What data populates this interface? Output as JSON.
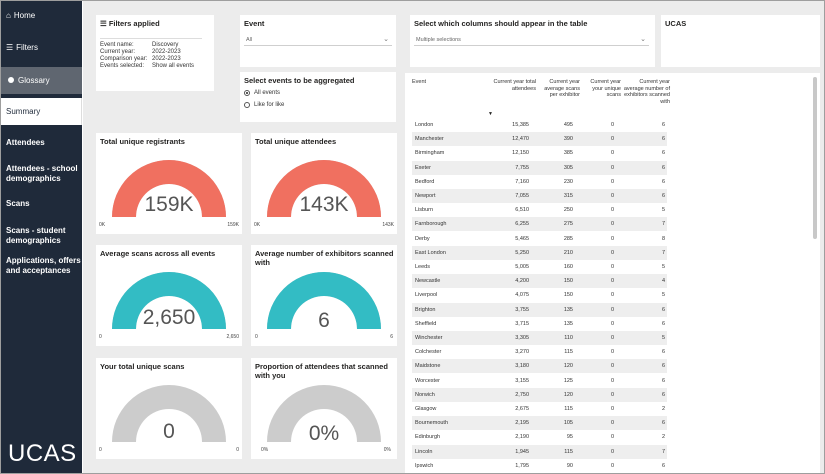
{
  "sidebar": {
    "home": "Home",
    "filters": "Filters",
    "glossary": "Glossary",
    "items": [
      {
        "label": "Summary"
      },
      {
        "label": "Attendees"
      },
      {
        "label": "Attendees - school demographics"
      },
      {
        "label": "Scans"
      },
      {
        "label": "Scans - student demographics"
      },
      {
        "label": "Applications, offers and acceptances"
      }
    ],
    "logo": "UCAS"
  },
  "filters_card": {
    "title": "Filters applied",
    "rows": [
      {
        "k": "Event name:",
        "v": "Discovery"
      },
      {
        "k": "Current year:",
        "v": "2022-2023"
      },
      {
        "k": "Comparison year:",
        "v": "2022-2023"
      },
      {
        "k": "Events selected:",
        "v": "Show all events"
      }
    ]
  },
  "event_filter": {
    "title": "Event",
    "value": "All"
  },
  "aggregate": {
    "title": "Select events to be aggregated",
    "options": [
      {
        "label": "All events",
        "selected": true
      },
      {
        "label": "Like for like",
        "selected": false
      }
    ]
  },
  "columns_filter": {
    "title": "Select which columns should appear in the table",
    "value": "Multiple selections"
  },
  "ucas_card": {
    "title": "UCAS"
  },
  "gauges": [
    {
      "title": "Total unique registrants",
      "value": "159K",
      "min": "0K",
      "max": "159K",
      "fraction": 1.0,
      "color": "#f07060"
    },
    {
      "title": "Total unique attendees",
      "value": "143K",
      "min": "0K",
      "max": "143K",
      "fraction": 1.0,
      "color": "#f07060"
    },
    {
      "title": "Average scans across all events",
      "value": "2,650",
      "min": "0",
      "max": "2,650",
      "fraction": 1.0,
      "color": "#33bcc4"
    },
    {
      "title": "Average number of exhibitors scanned with",
      "value": "6",
      "min": "0",
      "max": "6",
      "fraction": 1.0,
      "color": "#33bcc4"
    },
    {
      "title": "Your total unique scans",
      "value": "0",
      "min": "0",
      "max": "0",
      "fraction": 0.0,
      "color": "#cccccc"
    },
    {
      "title": "Proportion of attendees that scanned with you",
      "value": "0%",
      "min": "0%",
      "max": "0%",
      "fraction": 0.0,
      "color": "#cccccc"
    }
  ],
  "table": {
    "headers": [
      "Event",
      "Current year total attendees",
      "Current year average scans per exhibitor",
      "Current year your unique scans",
      "Current year average number of exhibitors scanned with"
    ],
    "rows": [
      [
        "London",
        "15,385",
        "495",
        "0",
        "6"
      ],
      [
        "Manchester",
        "12,470",
        "390",
        "0",
        "6"
      ],
      [
        "Birmingham",
        "12,150",
        "385",
        "0",
        "6"
      ],
      [
        "Exeter",
        "7,755",
        "305",
        "0",
        "6"
      ],
      [
        "Bedford",
        "7,160",
        "230",
        "0",
        "6"
      ],
      [
        "Newport",
        "7,055",
        "315",
        "0",
        "6"
      ],
      [
        "Lisburn",
        "6,510",
        "250",
        "0",
        "5"
      ],
      [
        "Farnborough",
        "6,255",
        "275",
        "0",
        "7"
      ],
      [
        "Derby",
        "5,465",
        "285",
        "0",
        "8"
      ],
      [
        "East London",
        "5,250",
        "210",
        "0",
        "7"
      ],
      [
        "Leeds",
        "5,005",
        "160",
        "0",
        "5"
      ],
      [
        "Newcastle",
        "4,200",
        "150",
        "0",
        "4"
      ],
      [
        "Liverpool",
        "4,075",
        "150",
        "0",
        "5"
      ],
      [
        "Brighton",
        "3,755",
        "135",
        "0",
        "6"
      ],
      [
        "Sheffield",
        "3,715",
        "135",
        "0",
        "6"
      ],
      [
        "Winchester",
        "3,305",
        "110",
        "0",
        "5"
      ],
      [
        "Colchester",
        "3,270",
        "115",
        "0",
        "6"
      ],
      [
        "Maidstone",
        "3,180",
        "120",
        "0",
        "6"
      ],
      [
        "Worcester",
        "3,155",
        "125",
        "0",
        "6"
      ],
      [
        "Norwich",
        "2,750",
        "120",
        "0",
        "6"
      ],
      [
        "Glasgow",
        "2,675",
        "115",
        "0",
        "2"
      ],
      [
        "Bournemouth",
        "2,195",
        "105",
        "0",
        "6"
      ],
      [
        "Edinburgh",
        "2,190",
        "95",
        "0",
        "2"
      ],
      [
        "Lincoln",
        "1,945",
        "115",
        "0",
        "7"
      ],
      [
        "Ipswich",
        "1,795",
        "90",
        "0",
        "6"
      ]
    ]
  }
}
